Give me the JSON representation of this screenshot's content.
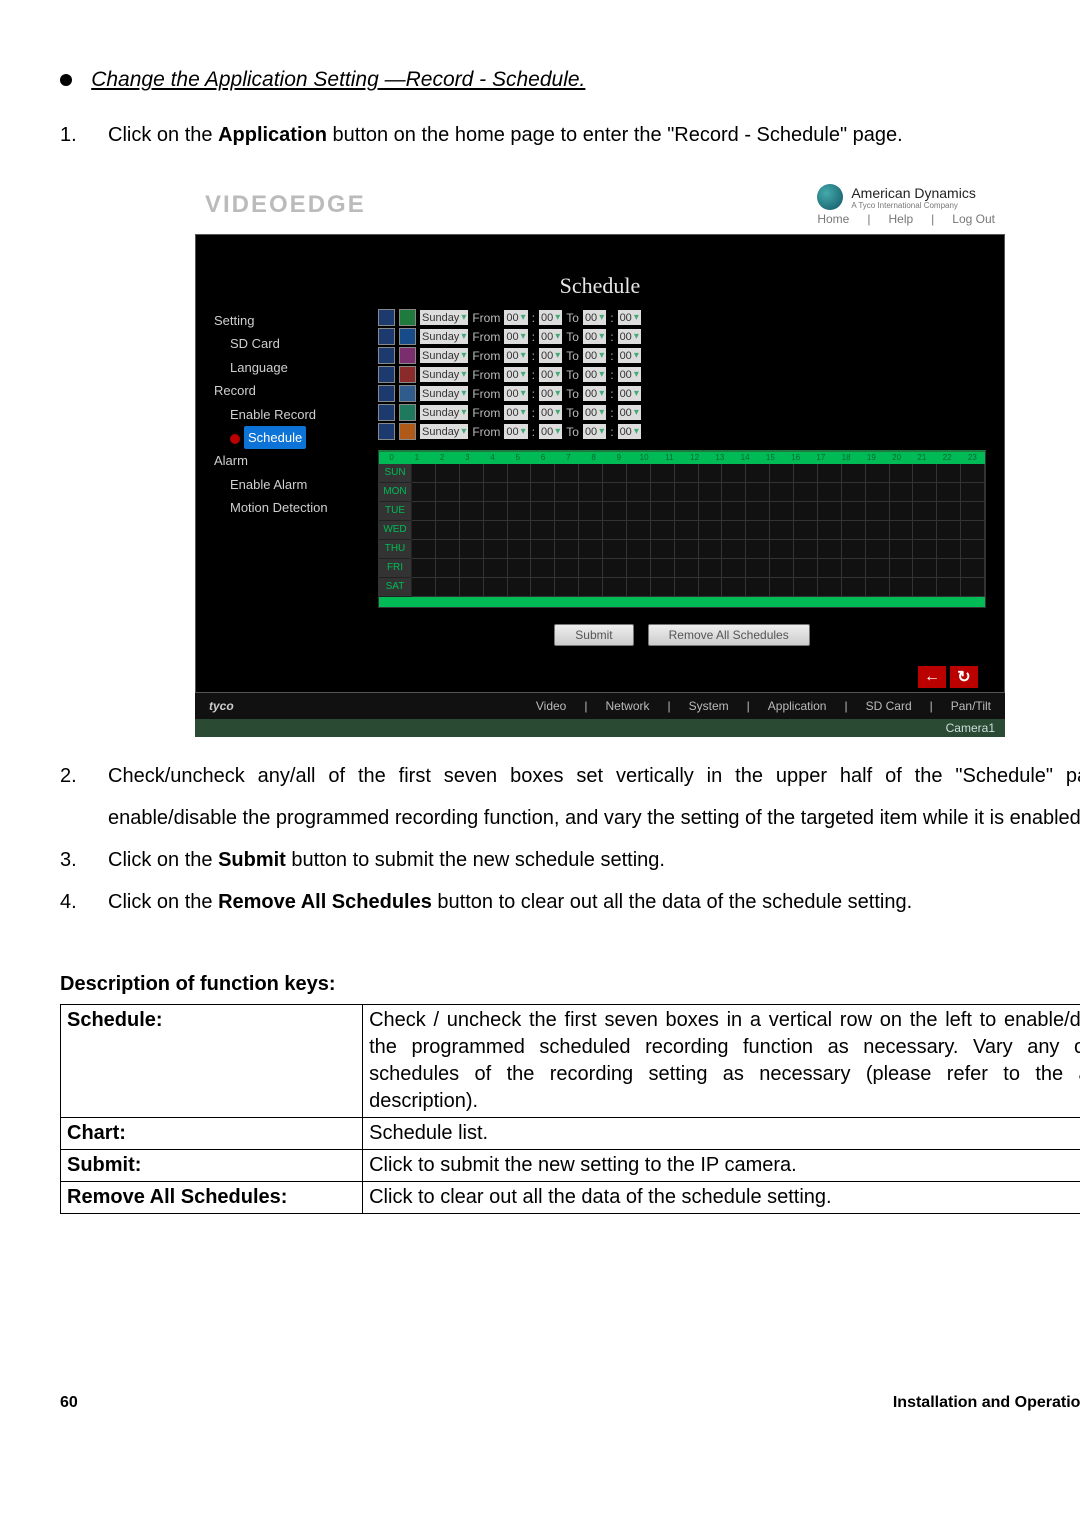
{
  "heading": "Change the Application Setting —Record - Schedule.",
  "step1": {
    "pre": "Click on the ",
    "bold": "Application",
    "post": " button on the home page to enter the \"Record - Schedule\" page."
  },
  "fig": {
    "logo": "VIDEOEDGE",
    "brand": "American Dynamics",
    "brand_sub": "A Tyco International Company",
    "links": [
      "Home",
      "Help",
      "Log Out"
    ],
    "title": "Schedule",
    "side": [
      {
        "l": 1,
        "t": "Setting"
      },
      {
        "l": 2,
        "t": "SD Card"
      },
      {
        "l": 2,
        "t": "Language"
      },
      {
        "l": 1,
        "t": "Record"
      },
      {
        "l": 2,
        "t": "Enable Record"
      },
      {
        "l": 2,
        "t": "Schedule",
        "active": true
      },
      {
        "l": 1,
        "t": "Alarm"
      },
      {
        "l": 2,
        "t": "Enable Alarm"
      },
      {
        "l": 2,
        "t": "Motion Detection"
      }
    ],
    "day_label": "Sunday",
    "from": "From",
    "to": "To",
    "zero": "00",
    "days": [
      "SUN",
      "MON",
      "TUE",
      "WED",
      "THU",
      "FRI",
      "SAT"
    ],
    "hours": [
      "0",
      "1",
      "2",
      "3",
      "4",
      "5",
      "6",
      "7",
      "8",
      "9",
      "10",
      "11",
      "12",
      "13",
      "14",
      "15",
      "16",
      "17",
      "18",
      "19",
      "20",
      "21",
      "22",
      "23"
    ],
    "btn_submit": "Submit",
    "btn_remove": "Remove All Schedules",
    "nav_tyco": "tyco",
    "nav_items": [
      "Video",
      "Network",
      "System",
      "Application",
      "SD Card",
      "Pan/Tilt"
    ],
    "camera": "Camera1"
  },
  "step2": "Check/uncheck any/all of the first seven boxes set vertically in the upper half of the \"Schedule\" page to enable/disable the programmed recording function, and vary the setting of the targeted item while it is enabled.",
  "step3": {
    "pre": "Click on the ",
    "bold": "Submit",
    "post": " button to submit the new schedule setting."
  },
  "step4": {
    "pre": "Click on the ",
    "bold": "Remove All Schedules",
    "post": " button to clear out all the data of the schedule setting."
  },
  "desc_head": "Description of function keys:",
  "table": [
    {
      "k": "Schedule:",
      "v": "Check / uncheck the first seven boxes in a vertical row on the left to enable/disable the programmed scheduled recording function as necessary. Vary any of the schedules of the recording setting as necessary (please refer to the above description)."
    },
    {
      "k": "Chart:",
      "v": "Schedule list."
    },
    {
      "k": "Submit:",
      "v": "Click to submit the new setting to the IP camera."
    },
    {
      "k": "Remove All Schedules:",
      "v": "Click to clear out all the data of the schedule setting."
    }
  ],
  "footer": {
    "page": "60",
    "guide": "Installation and Operation Guide"
  }
}
